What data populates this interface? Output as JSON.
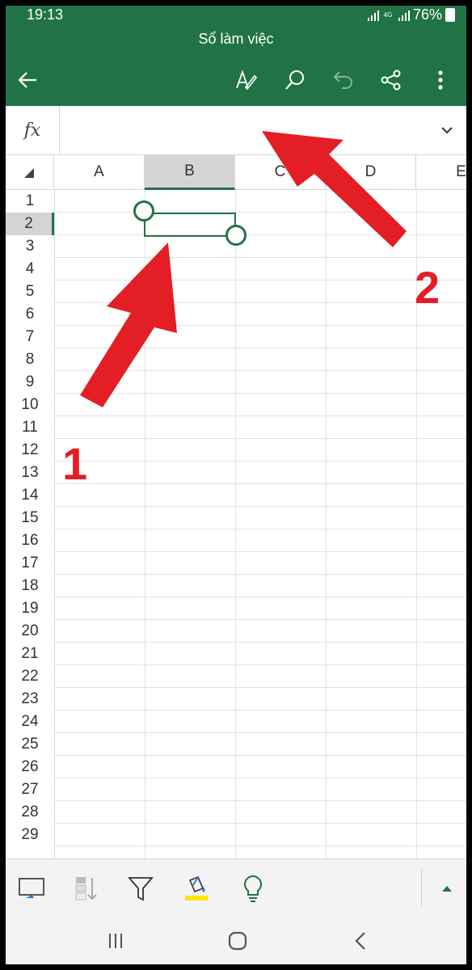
{
  "status": {
    "time": "19:13",
    "network": "4G",
    "battery": "76%"
  },
  "appbar": {
    "title": "Sổ làm việc"
  },
  "toolbar_icons": [
    "back-icon",
    "draw-icon",
    "search-icon",
    "undo-icon",
    "share-icon",
    "more-icon"
  ],
  "formula_bar": {
    "fx_label": "fx",
    "value": ""
  },
  "sheet": {
    "columns": [
      "A",
      "B",
      "C",
      "D",
      "E"
    ],
    "selected_column": "B",
    "rows": [
      "1",
      "2",
      "3",
      "4",
      "5",
      "6",
      "7",
      "8",
      "9",
      "10",
      "11",
      "12",
      "13",
      "14",
      "15",
      "16",
      "17",
      "18",
      "19",
      "20",
      "21",
      "22",
      "23",
      "24",
      "25",
      "26",
      "27",
      "28",
      "29"
    ],
    "selected_row": "2",
    "active_cell": "B2"
  },
  "bottom_toolbar_icons": [
    "view-icon",
    "sort-icon",
    "filter-icon",
    "fill-color-icon",
    "lightbulb-icon",
    "expand-up-icon"
  ],
  "colors": {
    "accent": "#217346",
    "fill_highlight": "#ffe600",
    "annotation": "#e31e24"
  },
  "annotations": {
    "label_1": "1",
    "label_2": "2"
  }
}
